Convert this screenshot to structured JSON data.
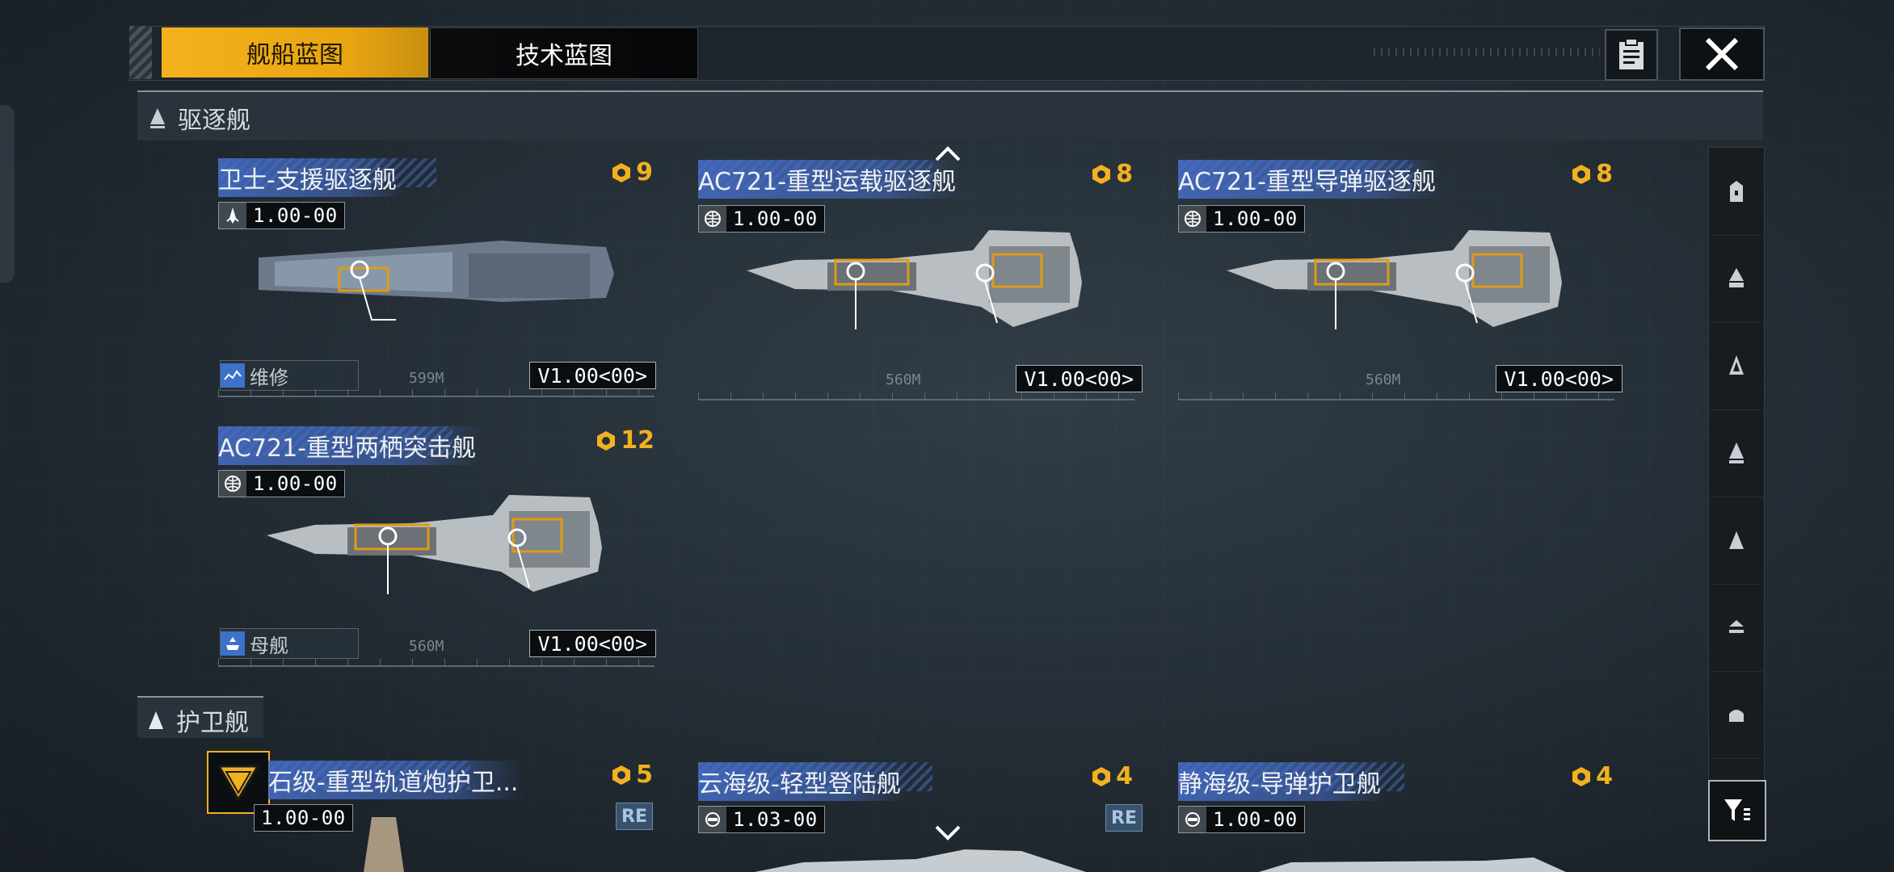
{
  "tabs": {
    "ship": "舰船蓝图",
    "tech": "技术蓝图"
  },
  "sections": {
    "destroyer": "驱逐舰",
    "frigate": "护卫舰"
  },
  "destroyers": [
    {
      "name": "卫士-支援驱逐舰",
      "cost": "9",
      "version": "1.00-00",
      "badge": "V1.00<00>",
      "role": "维修",
      "length": "599M",
      "icon": "ship-class-icon"
    },
    {
      "name": "AC721-重型运载驱逐舰",
      "cost": "8",
      "version": "1.00-00",
      "badge": "V1.00<00>",
      "length": "560M",
      "icon": "globe-icon"
    },
    {
      "name": "AC721-重型导弹驱逐舰",
      "cost": "8",
      "version": "1.00-00",
      "badge": "V1.00<00>",
      "length": "560M",
      "icon": "globe-icon"
    },
    {
      "name": "AC721-重型两栖突击舰",
      "cost": "12",
      "version": "1.00-00",
      "badge": "V1.00<00>",
      "role": "母舰",
      "length": "560M",
      "icon": "globe-icon"
    }
  ],
  "frigates": [
    {
      "name": "石级-重型轨道炮护卫...",
      "cost": "5",
      "version": "1.00-00",
      "tag": "RE"
    },
    {
      "name": "云海级-轻型登陆舰",
      "cost": "4",
      "version": "1.03-00",
      "tag": "RE"
    },
    {
      "name": "静海级-导弹护卫舰",
      "cost": "4",
      "version": "1.00-00"
    }
  ],
  "colors": {
    "accent": "#f3b21c",
    "title_band": "#466ec8",
    "bg": "#263038"
  }
}
